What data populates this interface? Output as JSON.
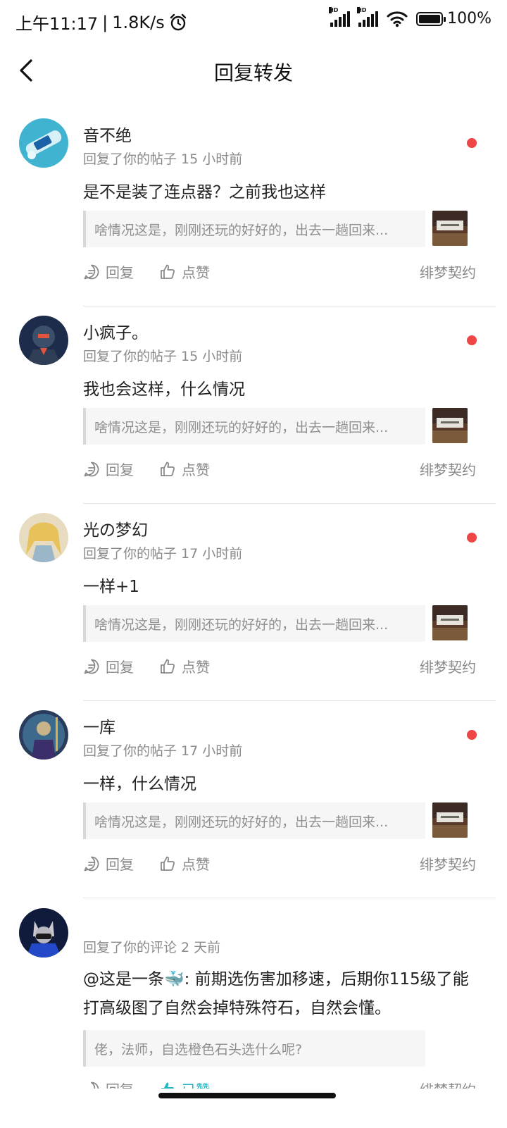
{
  "status_bar": {
    "time": "上午11:17",
    "speed": "1.8K/s",
    "battery": "100%",
    "alarm_icon": "alarm-icon",
    "signal_icon": "signal-icon",
    "wifi_icon": "wifi-icon"
  },
  "nav": {
    "title": "回复转发",
    "back_icon": "chevron-left-icon"
  },
  "items": [
    {
      "username": "音不绝",
      "meta": "回复了你的帖子 15 小时前",
      "reply": "是不是装了连点器？之前我也这样",
      "quote": "啥情况这是，刚刚还玩的好好的，出去一趟回来...",
      "reply_label": "回复",
      "like_label": "点赞",
      "forum": "绯梦契约",
      "unread": true
    },
    {
      "username": "小疯子。",
      "meta": "回复了你的帖子 15 小时前",
      "reply": "我也会这样，什么情况",
      "quote": "啥情况这是，刚刚还玩的好好的，出去一趟回来...",
      "reply_label": "回复",
      "like_label": "点赞",
      "forum": "绯梦契约",
      "unread": true
    },
    {
      "username": "光の梦幻",
      "meta": "回复了你的帖子 17 小时前",
      "reply": "一样+1",
      "quote": "啥情况这是，刚刚还玩的好好的，出去一趟回来...",
      "reply_label": "回复",
      "like_label": "点赞",
      "forum": "绯梦契约",
      "unread": true
    },
    {
      "username": "一库",
      "meta": "回复了你的帖子 17 小时前",
      "reply": "一样，什么情况",
      "quote": "啥情况这是，刚刚还玩的好好的，出去一趟回来...",
      "reply_label": "回复",
      "like_label": "点赞",
      "forum": "绯梦契约",
      "unread": true
    }
  ],
  "item5": {
    "meta": "回复了你的评论 2 天前",
    "reply_line1": "@这是一条🐳: 前期选伤害加移速，后期你115级了能",
    "reply_line2": "打高级图了自然会掉特殊符石，自然会懂。",
    "quote": "佬，法师，自选橙色石头选什么呢?",
    "reply_label": "回复",
    "like_label": "已赞",
    "forum": "绯梦契约"
  },
  "colors": {
    "unread_dot": "#ef4545",
    "meta_gray": "#8a8a8a",
    "quote_bg": "#f6f6f6",
    "like_active": "#1fb6c2"
  }
}
